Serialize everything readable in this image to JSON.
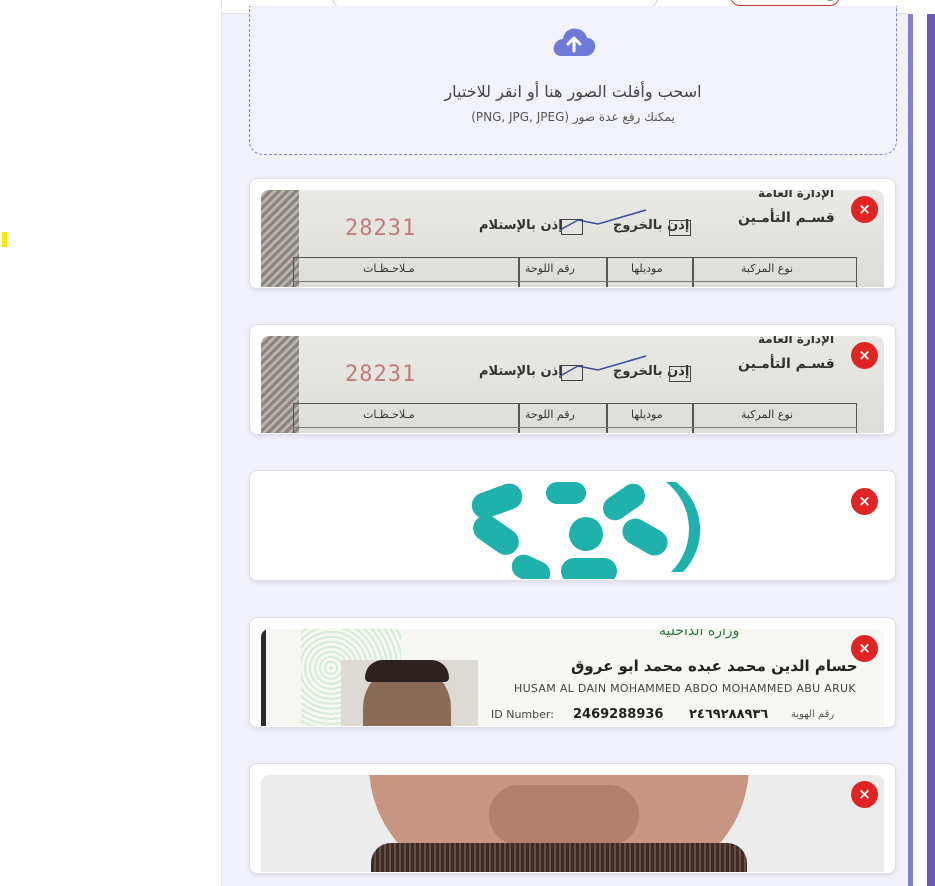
{
  "upload": {
    "title": "اسحب وأفلت الصور هنا أو انقر للاختيار",
    "subtitle": "يمكنك رفع عدة صور (PNG, JPG, JPEG)",
    "icon": "cloud-upload-icon",
    "accent": "#7c86d8"
  },
  "images": [
    {
      "kind": "document-form",
      "number": "28231",
      "exit_label": "إذن بالخروج",
      "receipt_label": "إذن بالإستلام",
      "dept_top": "الإدارة العامة",
      "dept": "قسـم التأمـين",
      "col_notes": "مـلاحـظـات",
      "col_plate": "رقم اللوحة",
      "col_model": "موديلها",
      "col_vehicle": "نوع المركبة"
    },
    {
      "kind": "document-form",
      "number": "28231",
      "exit_label": "إذن بالخروج",
      "receipt_label": "إذن بالإستلام",
      "dept_top": "الإدارة العامة",
      "dept": "قسـم التأمـين",
      "col_notes": "مـلاحـظـات",
      "col_plate": "رقم اللوحة",
      "col_model": "موديلها",
      "col_vehicle": "نوع المركبة"
    },
    {
      "kind": "logo",
      "logo_color": "#1fb2ad"
    },
    {
      "kind": "id-card",
      "ministry": "وزارة الداخلية",
      "name_ar": "حسام الدين محمد عبده محمد ابو عروق",
      "name_en": "HUSAM AL DAIN MOHAMMED ABDO MOHAMMED ABU ARUK",
      "id_label": "ID Number:",
      "id_value": "2469288936",
      "id_value_ar": "٢٤٦٩٢٨٨٩٣٦",
      "id_label_ar": "رقم الهوية"
    },
    {
      "kind": "face-photo"
    }
  ],
  "remove_glyph": "×",
  "colors": {
    "remove": "#e02424",
    "panel": "#f1f1fb",
    "rail": "#6b58b8"
  }
}
